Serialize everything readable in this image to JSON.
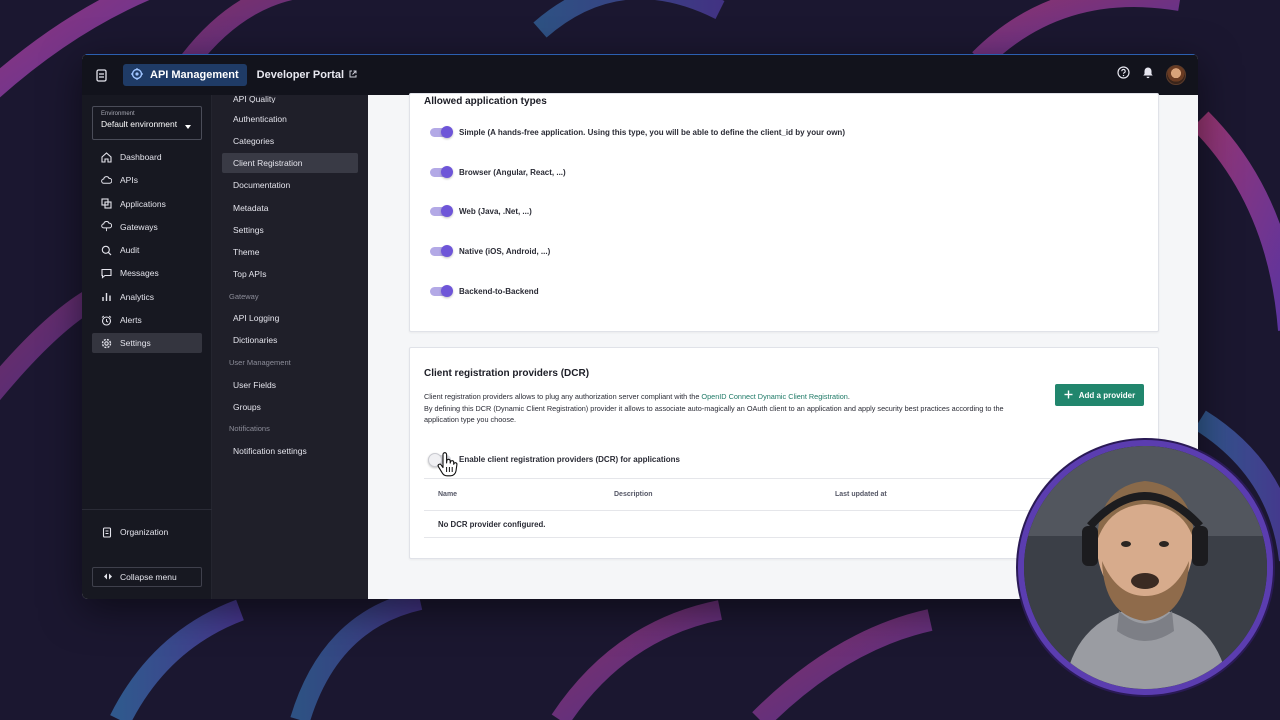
{
  "topbar": {
    "app_name": "API Management",
    "portal_link": "Developer Portal"
  },
  "leftnav": {
    "environment": {
      "label": "Environment",
      "value": "Default environment"
    },
    "items": [
      {
        "label": "Dashboard",
        "icon": "home-icon"
      },
      {
        "label": "APIs",
        "icon": "cloud-icon"
      },
      {
        "label": "Applications",
        "icon": "applications-icon"
      },
      {
        "label": "Gateways",
        "icon": "gateway-icon"
      },
      {
        "label": "Audit",
        "icon": "audit-icon"
      },
      {
        "label": "Messages",
        "icon": "message-icon"
      },
      {
        "label": "Analytics",
        "icon": "analytics-icon"
      },
      {
        "label": "Alerts",
        "icon": "alarm-icon"
      },
      {
        "label": "Settings",
        "icon": "gear-icon",
        "active": true
      }
    ],
    "organization": "Organization",
    "collapse": "Collapse menu"
  },
  "submenu": {
    "items": [
      {
        "type": "item",
        "label": "API Quality"
      },
      {
        "type": "item",
        "label": "Authentication"
      },
      {
        "type": "item",
        "label": "Categories"
      },
      {
        "type": "item",
        "label": "Client Registration",
        "active": true
      },
      {
        "type": "item",
        "label": "Documentation"
      },
      {
        "type": "item",
        "label": "Metadata"
      },
      {
        "type": "item",
        "label": "Settings"
      },
      {
        "type": "item",
        "label": "Theme"
      },
      {
        "type": "item",
        "label": "Top APIs"
      },
      {
        "type": "group",
        "label": "Gateway"
      },
      {
        "type": "item",
        "label": "API Logging"
      },
      {
        "type": "item",
        "label": "Dictionaries"
      },
      {
        "type": "group",
        "label": "User Management"
      },
      {
        "type": "item",
        "label": "User Fields"
      },
      {
        "type": "item",
        "label": "Groups"
      },
      {
        "type": "group",
        "label": "Notifications"
      },
      {
        "type": "item",
        "label": "Notification settings"
      }
    ]
  },
  "app_types": {
    "title": "Allowed application types",
    "items": [
      {
        "label": "Simple (A hands-free application. Using this type, you will be able to define the client_id by your own)",
        "enabled": true
      },
      {
        "label": "Browser (Angular, React, ...)",
        "enabled": true
      },
      {
        "label": "Web (Java, .Net, ...)",
        "enabled": true
      },
      {
        "label": "Native (iOS, Android, ...)",
        "enabled": true
      },
      {
        "label": "Backend-to-Backend",
        "enabled": true
      }
    ]
  },
  "dcr": {
    "title": "Client registration providers (DCR)",
    "desc_prefix": "Client registration providers allows to plug any authorization server compliant with the ",
    "desc_link": "OpenID Connect Dynamic Client Registration",
    "desc_suffix": ".",
    "desc_line2": "By defining this DCR (Dynamic Client Registration) provider it allows to associate auto-magically an OAuth client to an application and apply security best practices according to the application type you choose.",
    "add_button": "Add a provider",
    "enable_label": "Enable client registration providers (DCR) for applications",
    "enabled": false,
    "columns": [
      "Name",
      "Description",
      "Last updated at"
    ],
    "empty_message": "No DCR provider configured."
  },
  "colors": {
    "accent": "#6e55d8",
    "brand_button": "#21866d",
    "link": "#1f7a67",
    "webcam_ring": "#5b3db0"
  }
}
